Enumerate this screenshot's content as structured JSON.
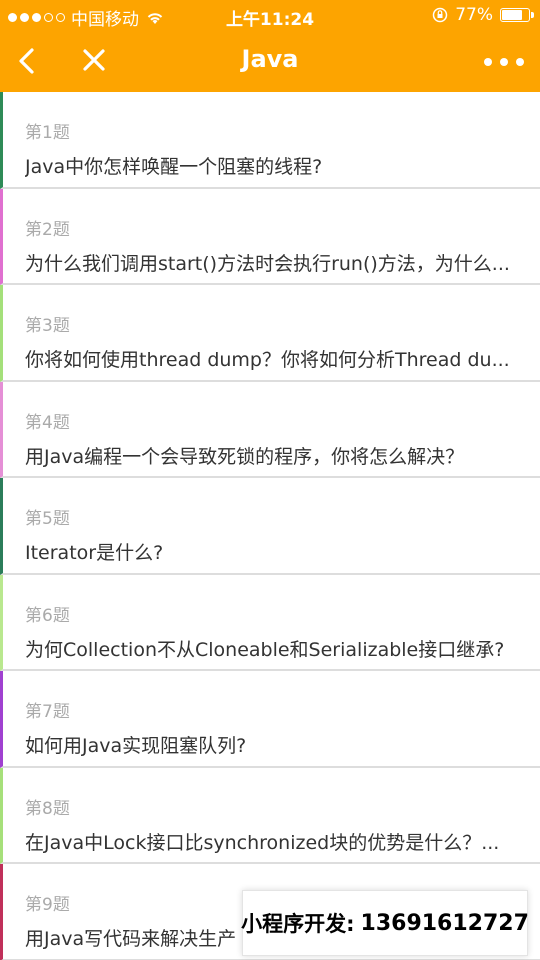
{
  "status_bar": {
    "carrier": "中国移动",
    "time": "上午11:24",
    "battery_percent": "77%",
    "battery_level": 0.77,
    "icons": [
      "signal-dots",
      "wifi-icon",
      "orientation-lock-icon",
      "battery-icon"
    ]
  },
  "nav": {
    "title": "Java",
    "back_icon": "chevron-left-icon",
    "close_icon": "close-icon",
    "more_icon": "more-dots-icon",
    "background": "#fda400"
  },
  "questions": [
    {
      "num": "第1题",
      "text": "Java中你怎样唤醒一个阻塞的线程?",
      "accent": "#2e8b57"
    },
    {
      "num": "第2题",
      "text": "为什么我们调用start()方法时会执行run()方法，为什么...",
      "accent": "#e070d0"
    },
    {
      "num": "第3题",
      "text": "你将如何使用thread dump？你将如何分析Thread du...",
      "accent": "#a4e07a"
    },
    {
      "num": "第4题",
      "text": "用Java编程一个会导致死锁的程序，你将怎么解决？",
      "accent": "#e58fd6"
    },
    {
      "num": "第5题",
      "text": "Iterator是什么?",
      "accent": "#2b7d5a"
    },
    {
      "num": "第6题",
      "text": "为何Collection不从Cloneable和Serializable接口继承?",
      "accent": "#b9e88f"
    },
    {
      "num": "第7题",
      "text": "如何用Java实现阻塞队列?",
      "accent": "#a040d0"
    },
    {
      "num": "第8题",
      "text": "在Java中Lock接口比synchronized块的优势是什么？...",
      "accent": "#a6e07a"
    },
    {
      "num": "第9题",
      "text": "用Java写代码来解决生产",
      "accent": "#c0305a"
    }
  ],
  "watermark": {
    "label": "小程序开发:",
    "phone": "13691612727"
  }
}
